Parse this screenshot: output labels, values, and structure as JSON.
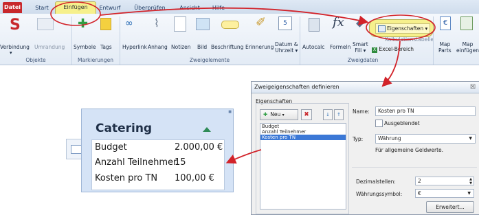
{
  "tabs": [
    "Datei",
    "Start",
    "Einfügen",
    "Entwurf",
    "Überprüfen",
    "Ansicht",
    "Hilfe"
  ],
  "ribbon": {
    "verbindung": "Verbindung",
    "umrandung": "Umrandung",
    "symbole": "Symbole",
    "tags": "Tags",
    "hyperlink": "Hyperlink",
    "anhang": "Anhang",
    "notizen": "Notizen",
    "bild": "Bild",
    "beschriftung": "Beschriftung",
    "erinnerung": "Erinnerung",
    "datum": "Datum &",
    "uhrzeit": "Uhrzeit ▾",
    "autocalc": "Autocalc",
    "formeln": "Formeln",
    "smart": "Smart",
    "fill": "Fill ▾",
    "eigenschaften": "Eigenschaften ▾",
    "kalk": "Kalkulationstabelle",
    "excel": "Excel-Bereich",
    "mapparts1": "Map",
    "mapparts2": "Parts",
    "mapein1": "Map",
    "mapein2": "einfügen",
    "groups": [
      "Objekte",
      "Markierungen",
      "Zweigelemente",
      "Zweigdaten"
    ]
  },
  "card": {
    "title": "Catering",
    "rows": [
      {
        "label": "Budget",
        "value": "2.000,00 €"
      },
      {
        "label": "Anzahl Teilnehmer",
        "value": "15"
      },
      {
        "label": "Kosten pro TN",
        "value": "100,00 €"
      }
    ]
  },
  "dialog": {
    "title": "Zweigeigenschaften definieren",
    "close": "☒",
    "group": "Eigenschaften",
    "neu": "Neu",
    "list": [
      "Budget",
      "Anzahl Teilnehmer",
      "Kosten pro TN"
    ],
    "name_label": "Name:",
    "name_value": "Kosten pro TN",
    "hidden": "Ausgeblendet",
    "typ_label": "Typ:",
    "typ_value": "Währung",
    "typ_desc": "Für allgemeine Geldwerte.",
    "dez_label": "Dezimalstellen:",
    "dez_value": "2",
    "sym_label": "Währungssymbol:",
    "sym_value": "€",
    "erweitert": "Erweitert..."
  },
  "colors": {
    "highlight": "#f6f08c",
    "arrow": "#d2232a",
    "datei": "#c8282c"
  }
}
